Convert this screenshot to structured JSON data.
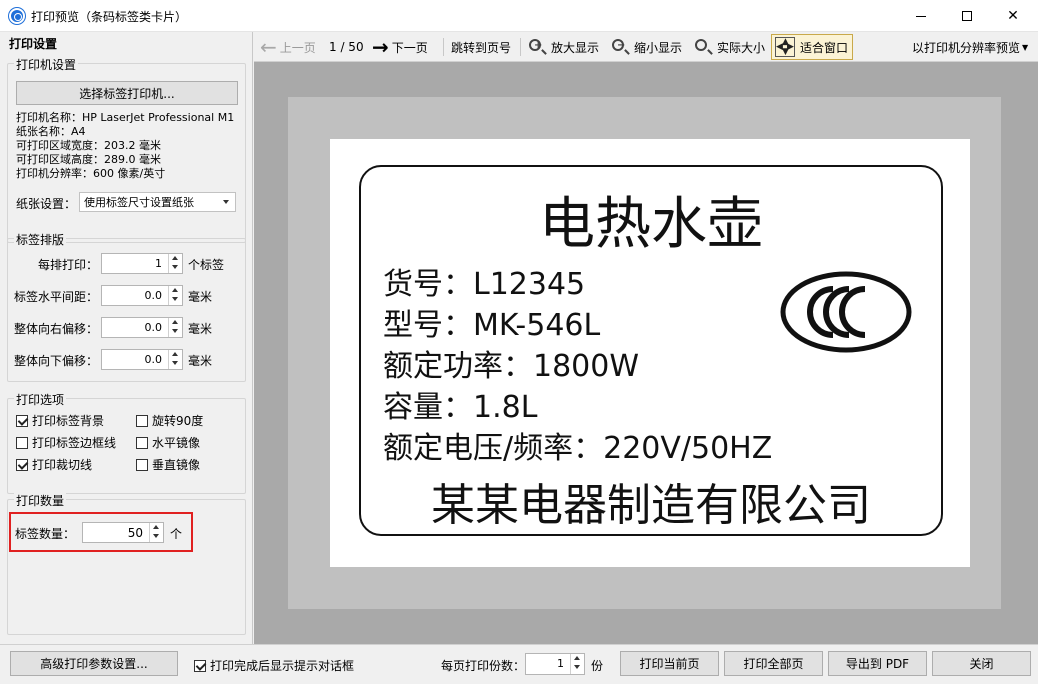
{
  "window": {
    "title": "打印预览（条码标签类卡片）",
    "minimize_glyph": "—",
    "close_glyph": "✕"
  },
  "left": {
    "header": "打印设置",
    "printer_group": {
      "title": "打印机设置",
      "select_button": "选择标签打印机...",
      "info": [
        "打印机名称：HP LaserJet Professional M1",
        "纸张名称：A4",
        "可打印区域宽度：203.2 毫米",
        "可打印区域高度：289.0 毫米",
        "打印机分辨率：600 像素/英寸"
      ],
      "paper_label": "纸张设置：",
      "paper_value": "使用标签尺寸设置纸张"
    },
    "layout_group": {
      "title": "标签排版",
      "rows": [
        {
          "label": "每排打印：",
          "value": "1",
          "unit": "个标签"
        },
        {
          "label": "标签水平间距：",
          "value": "0.0",
          "unit": "毫米"
        },
        {
          "label": "整体向右偏移：",
          "value": "0.0",
          "unit": "毫米"
        },
        {
          "label": "整体向下偏移：",
          "value": "0.0",
          "unit": "毫米"
        }
      ]
    },
    "options_group": {
      "title": "打印选项",
      "items": [
        {
          "label": "打印标签背景",
          "checked": true
        },
        {
          "label": "旋转90度",
          "checked": false
        },
        {
          "label": "打印标签边框线",
          "checked": false
        },
        {
          "label": "水平镜像",
          "checked": false
        },
        {
          "label": "打印裁切线",
          "checked": true
        },
        {
          "label": "垂直镜像",
          "checked": false
        }
      ]
    },
    "quantity_group": {
      "title": "打印数量",
      "label": "标签数量：",
      "value": "50",
      "unit": "个"
    }
  },
  "toolbar": {
    "prev": "上一页",
    "page": "1 / 50",
    "next": "下一页",
    "goto": "跳转到页号",
    "zoom_in": "放大显示",
    "zoom_out": "缩小显示",
    "actual": "实际大小",
    "fit": "适合窗口",
    "resolution": "以打印机分辨率预览"
  },
  "label": {
    "title": "电热水壶",
    "lines": [
      "货号：L12345",
      "型号：MK-546L",
      "额定功率：1800W",
      "容量：1.8L",
      "额定电压/频率：220V/50HZ"
    ],
    "footer": "某某电器制造有限公司"
  },
  "bottom": {
    "advanced_button": "高级打印参数设置...",
    "show_dialog_label": "打印完成后显示提示对话框",
    "show_dialog_checked": true,
    "copies_label": "每页打印份数：",
    "copies_value": "1",
    "copies_unit": "份",
    "print_current": "打印当前页",
    "print_all": "打印全部页",
    "export_pdf": "导出到 PDF",
    "close": "关闭"
  }
}
